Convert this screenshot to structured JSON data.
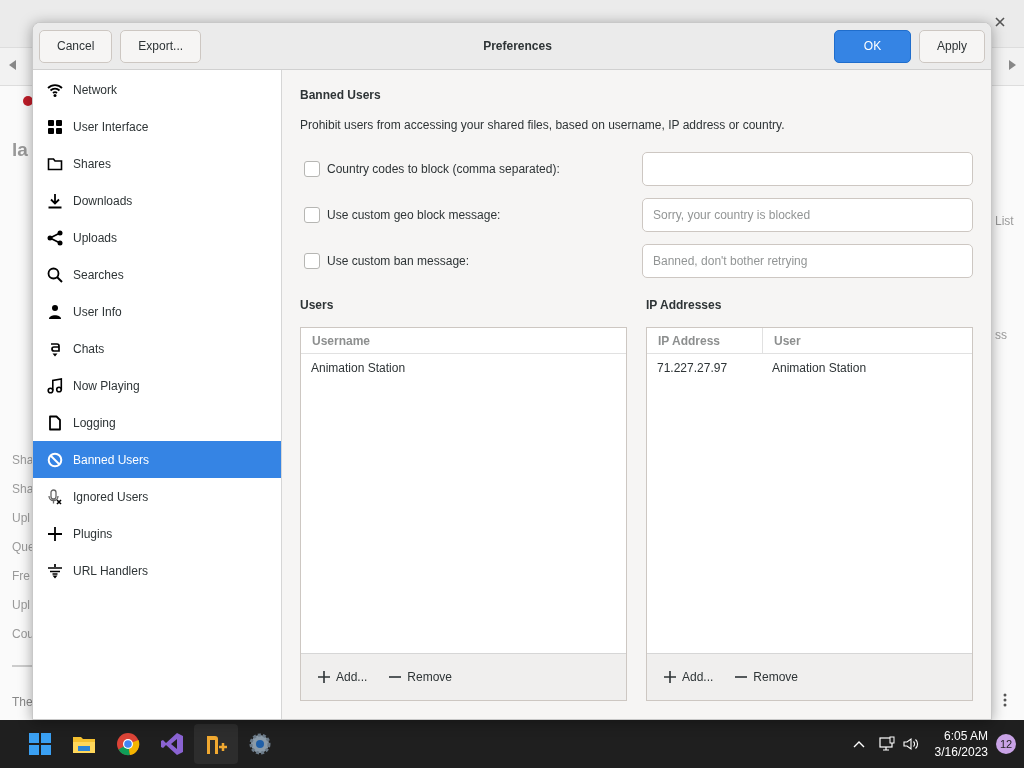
{
  "background_app": {
    "heading": "la",
    "side_fragments": [
      "Sha",
      "Sha",
      "Upl",
      "Que",
      "Fre",
      "Upl",
      "Cou"
    ],
    "footer_fragment": "The",
    "right_fragments": [
      "List",
      "ss"
    ]
  },
  "dialog": {
    "title": "Preferences",
    "left_buttons": [
      "Cancel",
      "Export..."
    ],
    "ok": "OK",
    "apply": "Apply"
  },
  "sidebar": {
    "items": [
      {
        "label": "Network",
        "selected": false
      },
      {
        "label": "User Interface",
        "selected": false
      },
      {
        "label": "Shares",
        "selected": false
      },
      {
        "label": "Downloads",
        "selected": false
      },
      {
        "label": "Uploads",
        "selected": false
      },
      {
        "label": "Searches",
        "selected": false
      },
      {
        "label": "User Info",
        "selected": false
      },
      {
        "label": "Chats",
        "selected": false
      },
      {
        "label": "Now Playing",
        "selected": false
      },
      {
        "label": "Logging",
        "selected": false
      },
      {
        "label": "Banned Users",
        "selected": true
      },
      {
        "label": "Ignored Users",
        "selected": false
      },
      {
        "label": "Plugins",
        "selected": false
      },
      {
        "label": "URL Handlers",
        "selected": false
      }
    ]
  },
  "content": {
    "title": "Banned Users",
    "description": "Prohibit users from accessing your shared files, based on username, IP address or country.",
    "options": [
      {
        "label": "Country codes to block (comma separated):",
        "checked": false
      },
      {
        "label": "Use custom geo block message:",
        "checked": false,
        "placeholder": "Sorry, your country is blocked"
      },
      {
        "label": "Use custom ban message:",
        "checked": false,
        "placeholder": "Banned, don't bother retrying"
      }
    ],
    "users": {
      "title": "Users",
      "columns": [
        "Username"
      ],
      "rows": [
        [
          "Animation Station"
        ]
      ],
      "add": "Add...",
      "remove": "Remove"
    },
    "ips": {
      "title": "IP Addresses",
      "columns": [
        "IP Address",
        "User"
      ],
      "rows": [
        [
          "71.227.27.97",
          "Animation Station"
        ]
      ],
      "add": "Add...",
      "remove": "Remove"
    }
  },
  "taskbar": {
    "time": "6:05 AM",
    "date": "3/16/2023",
    "notifications": "12"
  }
}
